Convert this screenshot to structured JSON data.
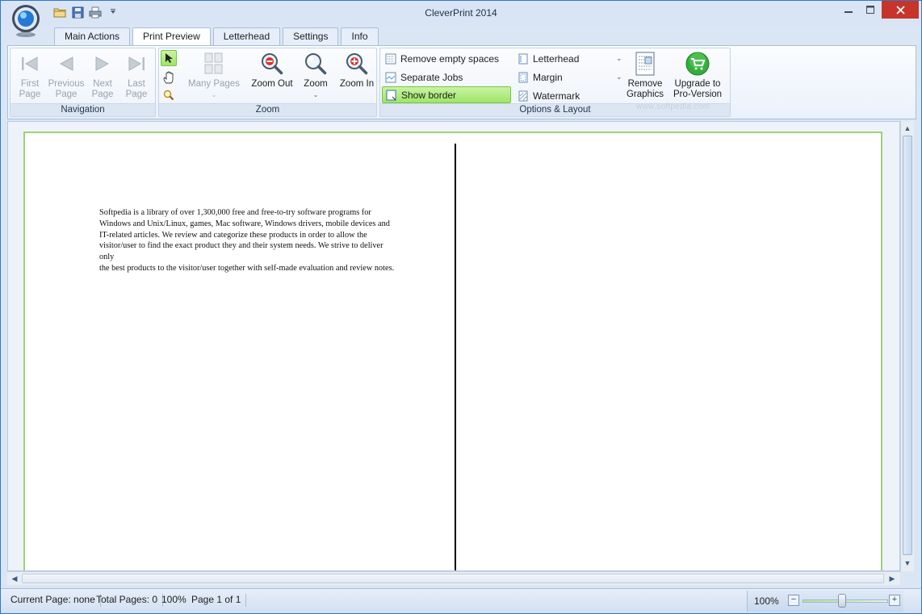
{
  "window": {
    "title": "CleverPrint 2014"
  },
  "quick_access": {
    "icons": [
      "open-folder-icon",
      "save-icon",
      "print-icon",
      "customize-arrow-icon"
    ]
  },
  "tabs": [
    {
      "label": "Main Actions",
      "active": false
    },
    {
      "label": "Print Preview",
      "active": true
    },
    {
      "label": "Letterhead",
      "active": false
    },
    {
      "label": "Settings",
      "active": false
    },
    {
      "label": "Info",
      "active": false
    }
  ],
  "ribbon": {
    "navigation": {
      "label": "Navigation",
      "first": {
        "line1": "First",
        "line2": "Page"
      },
      "previous": {
        "line1": "Previous",
        "line2": "Page"
      },
      "next": {
        "line1": "Next",
        "line2": "Page"
      },
      "last": {
        "line1": "Last",
        "line2": "Page"
      }
    },
    "zoom": {
      "label": "Zoom",
      "many_pages": "Many Pages",
      "zoom_out": "Zoom Out",
      "zoom": "Zoom",
      "zoom_in": "Zoom In"
    },
    "options": {
      "label": "Options & Layout",
      "remove_empty_spaces": "Remove empty spaces",
      "separate_jobs": "Separate Jobs",
      "show_border": "Show border",
      "letterhead": "Letterhead",
      "margin": "Margin",
      "watermark": "Watermark",
      "remove_graphics": {
        "line1": "Remove",
        "line2": "Graphics"
      },
      "upgrade": {
        "line1": "Upgrade to",
        "line2": "Pro-Version"
      }
    }
  },
  "document": {
    "lines": [
      "Softpedia is a library of over 1,300,000 free and free-to-try software programs for",
      "Windows and Unix/Linux, games, Mac software, Windows drivers, mobile devices and",
      "IT-related articles. We review and categorize these products in order to allow the",
      "visitor/user to find the exact product they and their system needs. We strive to deliver only",
      "the best products to the visitor/user together with self-made evaluation and review notes."
    ]
  },
  "status": {
    "current_page": "Current Page: none",
    "total_pages": "Total Pages: 0",
    "zoom": "100%",
    "page_of": "Page 1 of 1",
    "zoom_right": "100%",
    "zoom_slider_percent": 100
  },
  "watermark_text": "www.softpedia.com",
  "colors": {
    "accent": "#2e78c9",
    "active_option": "#9ee565",
    "page_border": "#9fd07a",
    "close_button": "#c7342a"
  }
}
